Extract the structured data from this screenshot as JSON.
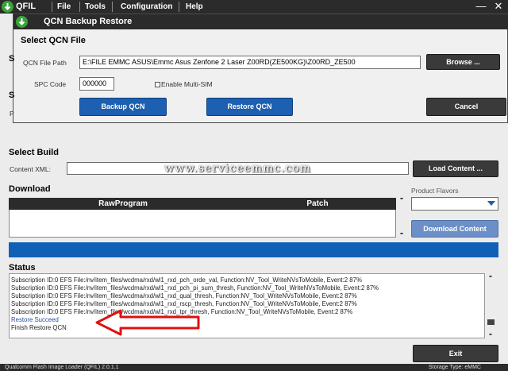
{
  "app": {
    "name": "QFIL",
    "menu": [
      "File",
      "Tools",
      "Configuration",
      "Help"
    ],
    "window_controls": {
      "minimize": "—",
      "close": "✕"
    }
  },
  "dialog": {
    "title": "QCN Backup Restore",
    "heading": "Select QCN File",
    "qcn_path_label": "QCN File Path",
    "qcn_path_value": "E:\\FILE EMMC ASUS\\Emmc Asus Zenfone 2 Laser Z00RD(ZE500KG)\\Z00RD_ZE500",
    "browse_label": "Browse ...",
    "spc_label": "SPC Code",
    "spc_value": "000000",
    "multisim_label": "Enable Multi-SIM",
    "backup_label": "Backup QCN",
    "restore_label": "Restore QCN",
    "cancel_label": "Cancel"
  },
  "main": {
    "hidden_labels": [
      "S",
      "S",
      "P"
    ],
    "select_build_title": "Select Build",
    "content_xml_label": "Content XML:",
    "load_content_label": "Load Content ...",
    "watermark": "www.serviceemmc.com",
    "download_title": "Download",
    "columns": [
      "RawProgram",
      "Patch"
    ],
    "product_flavors_label": "Product Flavors",
    "download_content_label": "Download Content",
    "status_title": "Status",
    "status_lines": [
      "Subscription ID:0 EFS File:/nv/item_files/wcdma/rxd/wl1_rxd_pch_orde_val, Function:NV_Tool_WriteNVsToMobile, Event:2  87%",
      "Subscription ID:0 EFS File:/nv/item_files/wcdma/rxd/wl1_rxd_pch_pi_sum_thresh, Function:NV_Tool_WriteNVsToMobile, Event:2  87%",
      "Subscription ID:0 EFS File:/nv/item_files/wcdma/rxd/wl1_rxd_qual_thresh, Function:NV_Tool_WriteNVsToMobile, Event:2  87%",
      "Subscription ID:0 EFS File:/nv/item_files/wcdma/rxd/wl1_rxd_rscp_thresh, Function:NV_Tool_WriteNVsToMobile, Event:2  87%",
      "Subscription ID:0 EFS File:/nv/item_files/wcdma/rxd/wl1_rxd_tpr_thresh, Function:NV_Tool_WriteNVsToMobile, Event:2  87%",
      "Restore Succeed",
      "Finish Restore QCN"
    ],
    "exit_label": "Exit",
    "statusbar_left": "Qualcomm Flash Image Loader (QFIL)  2.0.1.1",
    "statusbar_right": "Storage Type: eMMC"
  },
  "colors": {
    "accent_blue": "#1d5fb0",
    "progress_blue": "#1060b7",
    "annotation_red": "#e01010",
    "titlebar": "#2b2b2b"
  }
}
